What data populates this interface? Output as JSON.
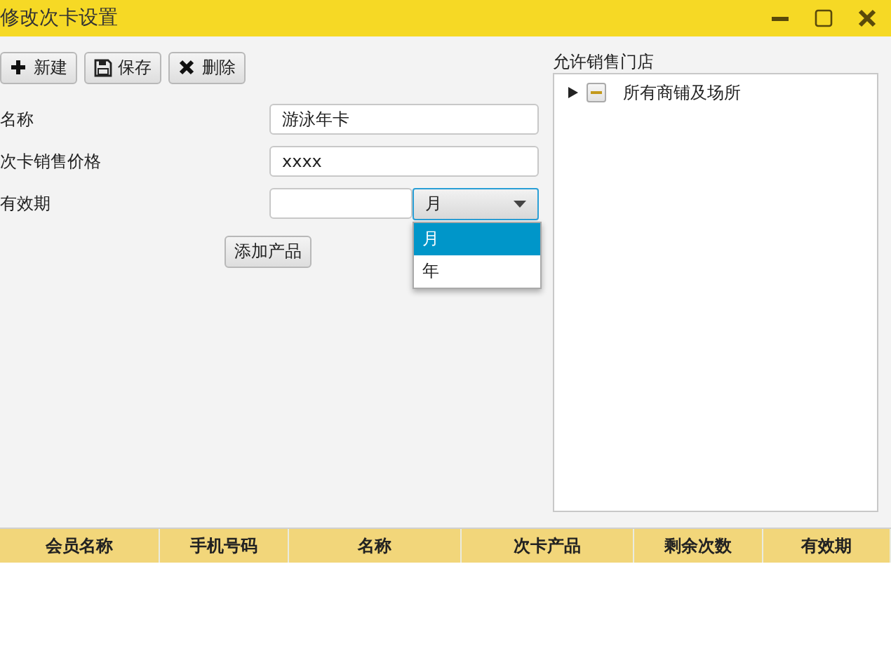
{
  "window": {
    "title": "修改次卡设置"
  },
  "toolbar": [
    {
      "kind": "new",
      "label": "新建"
    },
    {
      "kind": "save",
      "label": "保存"
    },
    {
      "kind": "delete",
      "label": "删除"
    }
  ],
  "form": {
    "fields": [
      {
        "kind": "text",
        "label": "名称",
        "value": "游泳年卡"
      },
      {
        "kind": "text",
        "label": "次卡销售价格",
        "value": "xxxx"
      },
      {
        "kind": "period",
        "label": "有效期",
        "unit": {
          "value": "月",
          "open": true,
          "options": [
            {
              "label": "月",
              "selected": true
            },
            {
              "label": "年",
              "selected": false
            }
          ]
        }
      }
    ],
    "add_button": "添加产品"
  },
  "stores": {
    "label": "允许销售门店",
    "tree": [
      {
        "label": "所有商铺及场所",
        "expanded": false,
        "indeterminate": true
      }
    ]
  },
  "table": {
    "columns": [
      "会员名称",
      "手机号码",
      "名称",
      "次卡产品",
      "剩余次数",
      "有效期"
    ]
  }
}
